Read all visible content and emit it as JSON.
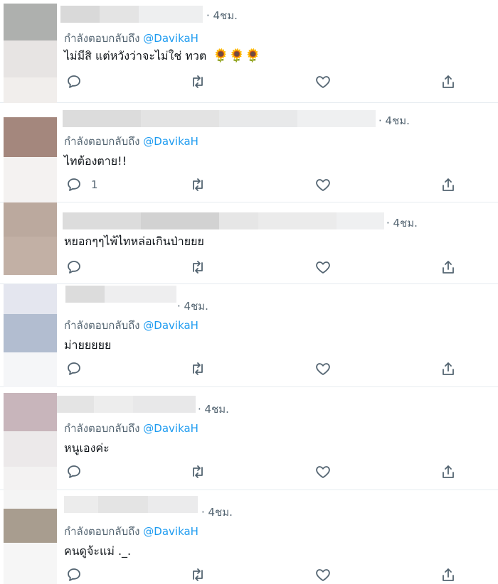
{
  "icons": {
    "reply": "reply-icon",
    "retweet": "retweet-icon",
    "like": "heart-icon",
    "share": "share-icon",
    "flower": "sunflower-emoji"
  },
  "colors": {
    "handle": "#1d9bf0",
    "muted": "#536471",
    "divider": "#e6ecf0"
  },
  "tweets": [
    {
      "time": "· 4ชม.",
      "reply_prefix": "กำลังตอบกลับถึง",
      "reply_handle": "@DavikaH",
      "text": "ไม่มีสิ แต่หวังว่าจะไม่ใช่ ทวต",
      "emoji": "🌻🌻🌻",
      "reply_count": ""
    },
    {
      "time": "· 4ชม.",
      "reply_prefix": "กำลังตอบกลับถึง",
      "reply_handle": "@DavikaH",
      "text": "ไทต้องตาย!!",
      "reply_count": "1"
    },
    {
      "time": "· 4ชม.",
      "text": "หยอกๆๆไพ้ไทหล่อเกินป่ายยย",
      "reply_count": ""
    },
    {
      "time": "· 4ชม.",
      "reply_prefix": "กำลังตอบกลับถึง",
      "reply_handle": "@DavikaH",
      "text": "ม่ายยยยย",
      "reply_count": ""
    },
    {
      "time": "· 4ชม.",
      "reply_prefix": "กำลังตอบกลับถึง",
      "reply_handle": "@DavikaH",
      "text": "หนูเองค่ะ",
      "reply_count": ""
    },
    {
      "time": "· 4ชม.",
      "reply_prefix": "กำลังตอบกลับถึง",
      "reply_handle": "@DavikaH",
      "text": "คนดูจ้ะแม่ ._.",
      "reply_count": ""
    }
  ]
}
